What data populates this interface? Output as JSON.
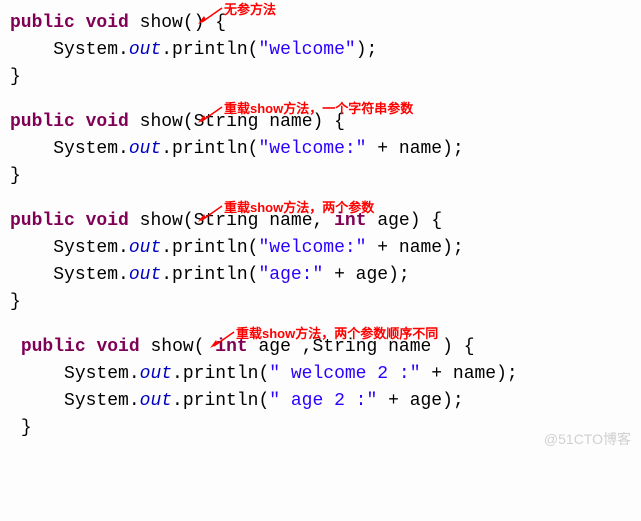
{
  "blocks": [
    {
      "annotation": "无参方法",
      "kw1": "public",
      "kw2": "void",
      "name": "show",
      "params_open": "() {",
      "sys": "System.",
      "out": "out",
      "call": ".println(",
      "str1": "\"welcome\"",
      "close_call": ");",
      "close": "}"
    },
    {
      "annotation": "重载show方法，一个字符串参数",
      "kw1": "public",
      "kw2": "void",
      "name": "show",
      "params_open": "(String name) {",
      "sys": "System.",
      "out": "out",
      "call": ".println(",
      "str1": "\"welcome:\"",
      "plus": " + name);",
      "close": "}"
    },
    {
      "annotation": "重载show方法，两个参数",
      "kw1": "public",
      "kw2": "void",
      "name": "show",
      "p_open": "(String name, ",
      "kw3": "int",
      "p_rest": " age) {",
      "sys": "System.",
      "out": "out",
      "call": ".println(",
      "str1": "\"welcome:\"",
      "plus1": " + name);",
      "sys2": "System.",
      "out2": "out",
      "call2": ".println(",
      "str2": "\"age:\"",
      "plus2": " + age);",
      "close": "}"
    },
    {
      "annotation": "重载show方法，两个参数顺序不同",
      "kw1": "public",
      "kw2": "void",
      "name": "show",
      "p_open": "( ",
      "kw3": "int",
      "p_mid": " age ,String name ) {",
      "sys": "System.",
      "out": "out",
      "call": ".println(",
      "str1": "\" welcome 2 :\"",
      "plus1": " + name);",
      "sys2": "System.",
      "out2": "out",
      "call2": ".println(",
      "str2": "\" age 2 :\"",
      "plus2": " + age);",
      "close": "}"
    }
  ],
  "watermark": "@51CTO博客"
}
